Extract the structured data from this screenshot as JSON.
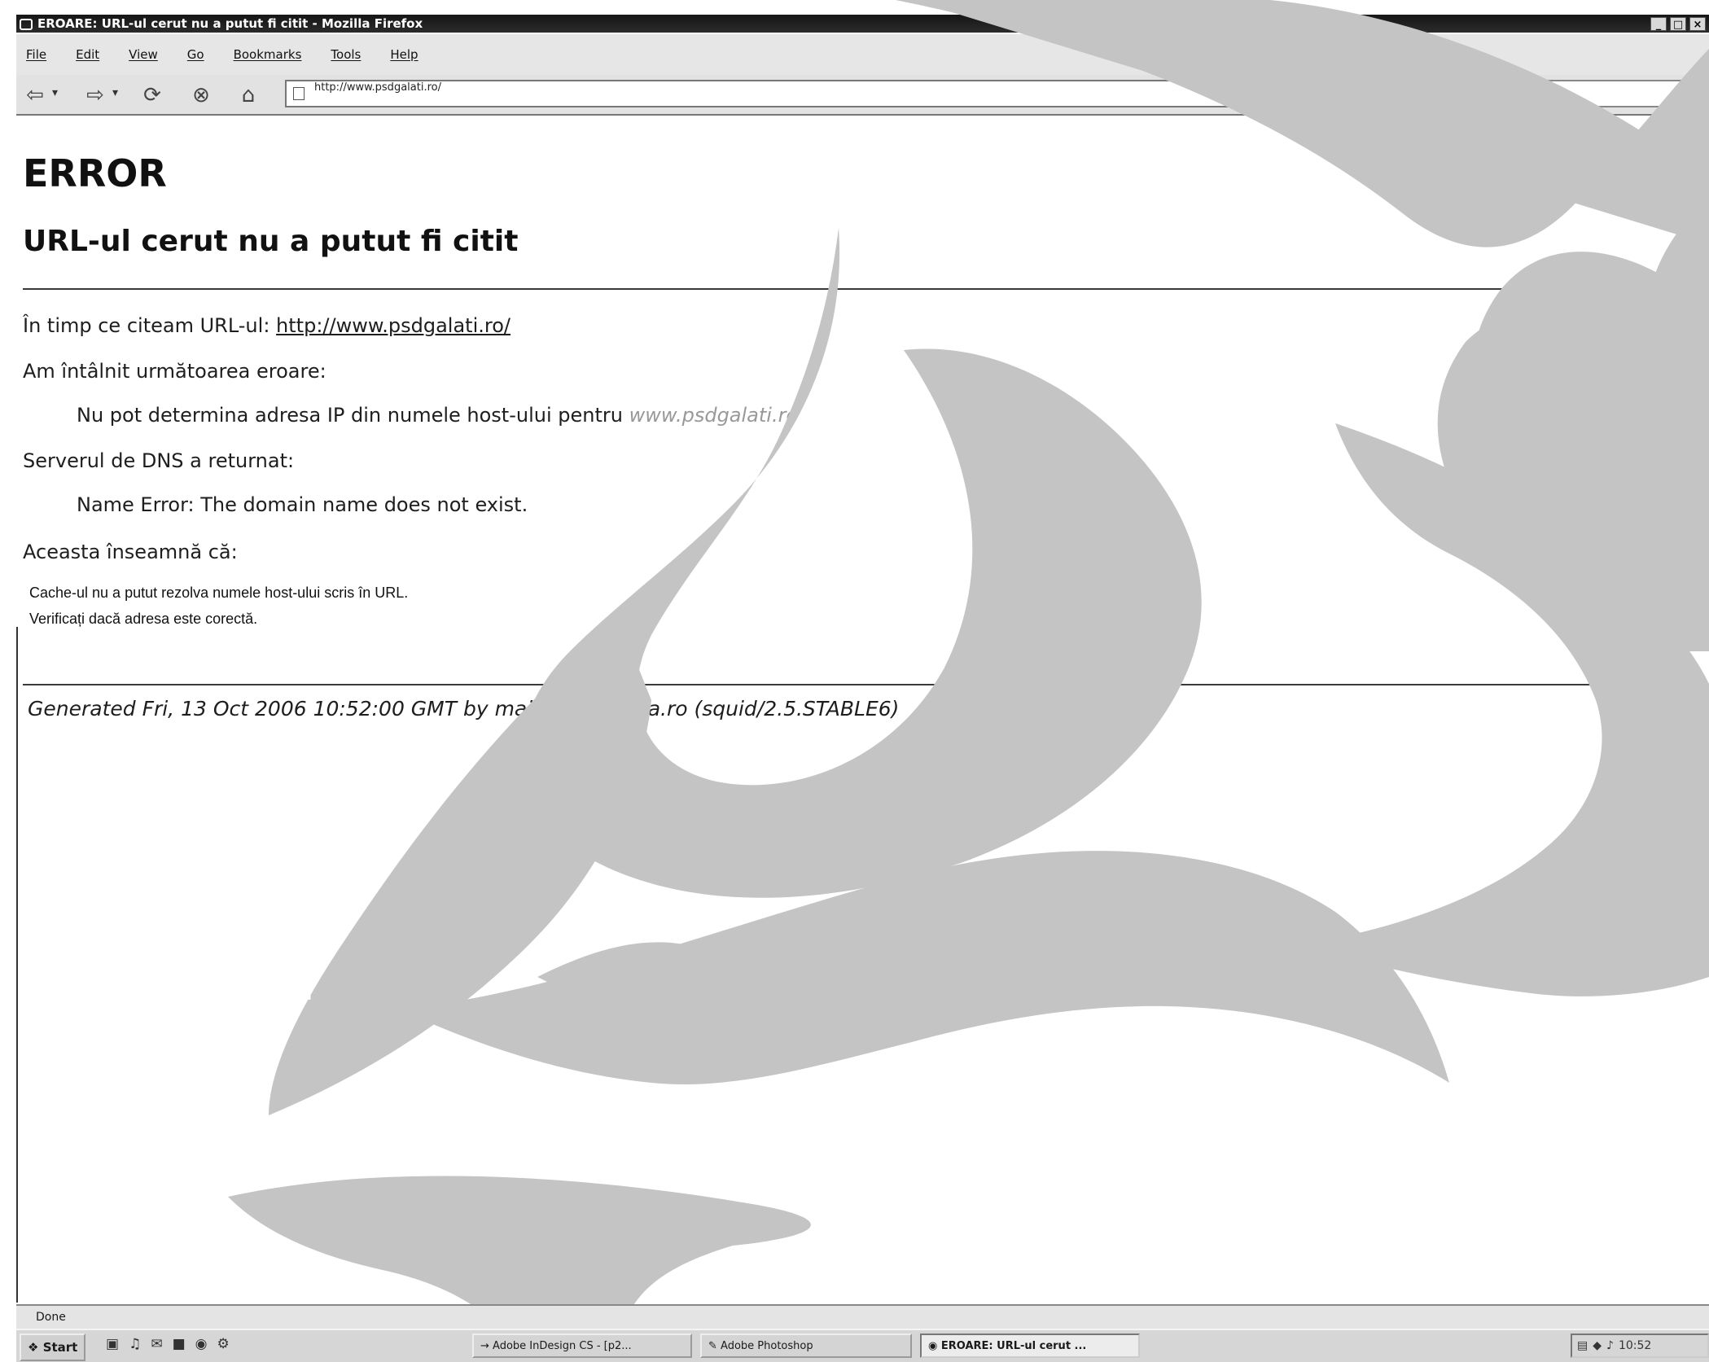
{
  "window": {
    "title": "EROARE: URL-ul cerut nu a putut fi citit - Mozilla Firefox",
    "buttons": [
      "_",
      "□",
      "×"
    ]
  },
  "menu": [
    "File",
    "Edit",
    "View",
    "Go",
    "Bookmarks",
    "Tools",
    "Help"
  ],
  "toolbar": {
    "url": "http://www.psdgalati.ro/",
    "icons": [
      "back-icon",
      "forward-icon",
      "reload-icon",
      "stop-icon",
      "home-icon",
      "go-icon",
      "search-icon"
    ]
  },
  "page": {
    "heading": "ERROR",
    "subheading": "URL-ul cerut nu a putut fi citit",
    "reading_prefix": "În timp ce citeam URL-ul:",
    "reading_url": "http://www.psdgalati.ro/",
    "encountered": "Am întâlnit următoarea eroare:",
    "error_prefix": "Nu pot determina adresa IP din numele host-ului pentru",
    "error_host": "www.psdgalati.ro",
    "dns_returned": "Serverul de DNS a returnat:",
    "dns_error": "Name Error: The domain name does not exist.",
    "means": "Aceasta înseamnă că:",
    "means_line1": "Cache-ul nu a putut rezolva numele host-ului scris în URL.",
    "means_line2": "Verificați dacă adresa este corectă.",
    "generated": "Generated Fri, 13 Oct 2006 10:52:00 GMT by mail.viata-libera.ro (squid/2.5.STABLE6)"
  },
  "status": "Done",
  "taskbar": {
    "start": "Start",
    "tasks": [
      "Adobe InDesign CS - [p2...",
      "Adobe Photoshop",
      "EROARE: URL-ul cerut ..."
    ],
    "clock": "10:52"
  },
  "colors": {
    "watermark": "#c4c4c4",
    "titlebar": "#1e1e1e"
  }
}
